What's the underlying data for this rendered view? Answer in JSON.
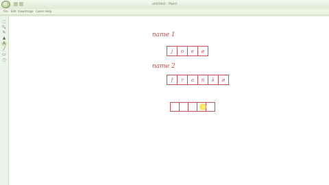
{
  "window": {
    "title": "untitled - Paint"
  },
  "menu": [
    "File",
    "Edit",
    "View",
    "Image",
    "Colors",
    "Help"
  ],
  "tools": [
    {
      "icon": "select-icon",
      "glyph": "⬚"
    },
    {
      "icon": "zoom-icon",
      "glyph": "🔍"
    },
    {
      "icon": "pencil-icon",
      "glyph": "✎"
    },
    {
      "icon": "fill-icon",
      "glyph": "▲"
    },
    {
      "icon": "text-icon",
      "glyph": "A"
    },
    {
      "icon": "brush-icon",
      "glyph": "╱"
    },
    {
      "icon": "eraser-icon",
      "glyph": "▭"
    },
    {
      "icon": "shape-icon",
      "glyph": "○"
    }
  ],
  "canvas": {
    "ink_color": "#c24a4a",
    "label1": "name 1",
    "array1": [
      "j",
      "o",
      "e",
      "ø"
    ],
    "label2": "name 2",
    "array2": [
      "f",
      "r",
      "a",
      "n",
      "k",
      "ø"
    ],
    "array3": [
      "",
      "",
      "",
      "",
      ""
    ]
  }
}
